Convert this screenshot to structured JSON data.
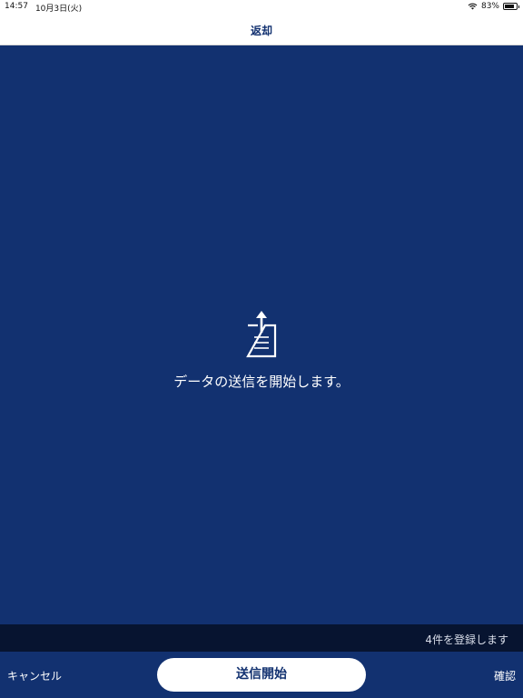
{
  "status_bar": {
    "time": "14:57",
    "date": "10月3日(火)",
    "battery": "83%",
    "battery_level": 0.83,
    "wifi_icon": "wifi-icon",
    "battery_icon": "battery-icon"
  },
  "nav": {
    "title": "返却"
  },
  "main": {
    "icon": "upload-document-icon",
    "message": "データの送信を開始します。"
  },
  "info": {
    "text": "4件を登録します"
  },
  "toolbar": {
    "cancel_label": "キャンセル",
    "start_label": "送信開始",
    "confirm_label": "確認"
  },
  "colors": {
    "primary": "#123170",
    "info_bar": "#071430",
    "surface": "#ffffff"
  }
}
